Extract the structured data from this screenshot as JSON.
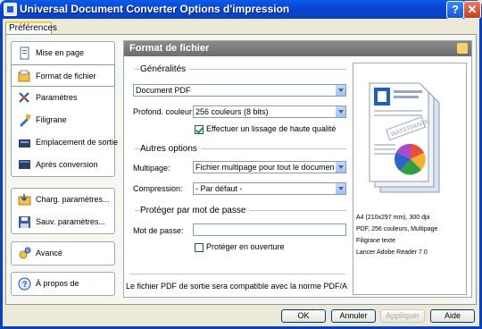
{
  "window": {
    "title": "Universal Document Converter Options d'impression",
    "help_label": "?",
    "close_label": "✕"
  },
  "tabs": [
    {
      "label": "Préférences"
    }
  ],
  "nav": {
    "group1": [
      {
        "label": "Mise en page",
        "icon": "page-setup-icon"
      },
      {
        "label": "Format de fichier",
        "icon": "file-format-icon"
      },
      {
        "label": "Paramètres",
        "icon": "parameters-icon"
      },
      {
        "label": "Filigrane",
        "icon": "watermark-icon"
      },
      {
        "label": "Emplacement de sortie",
        "icon": "output-location-icon"
      },
      {
        "label": "Après conversion",
        "icon": "after-conversion-icon"
      }
    ],
    "group2": [
      {
        "label": "Charg. paramètres...",
        "icon": "load-settings-icon"
      },
      {
        "label": "Sauv. paramètres...",
        "icon": "save-settings-icon"
      }
    ],
    "group3": [
      {
        "label": "Avancé",
        "icon": "advanced-icon"
      }
    ],
    "group4": [
      {
        "label": "À propos de",
        "icon": "about-icon"
      }
    ]
  },
  "panel": {
    "header": "Format de fichier",
    "general": {
      "title": "Généralités",
      "format_value": "Document PDF",
      "depth_label": "Profond. couleur:",
      "depth_value": "256 couleurs (8 bits)",
      "smooth_label": "Effectuer un lissage de haute qualité"
    },
    "other": {
      "title": "Autres options",
      "multipage_label": "Multipage:",
      "multipage_value": "Fichier multipage pour tout le document",
      "compression_label": "Compression:",
      "compression_value": "- Par défaut -"
    },
    "protect": {
      "title": "Protéger par mot de passe",
      "password_label": "Mot de passe:",
      "password_value": "",
      "protect_open_label": "Protéger en ouverture"
    },
    "footnote": "Le fichier PDF de sortie sera compatible avec la norme PDF/A"
  },
  "preview": {
    "watermark_text": "WATERMARK",
    "info": [
      "A4 (210x297 mm), 300 dpi",
      "PDF, 256 couleurs, Multipage",
      "Filigrane texte",
      "Lancer Adobe Reader 7.0"
    ]
  },
  "buttons": {
    "ok": "OK",
    "cancel": "Annuler",
    "apply": "Appliquer",
    "help": "Aide"
  }
}
